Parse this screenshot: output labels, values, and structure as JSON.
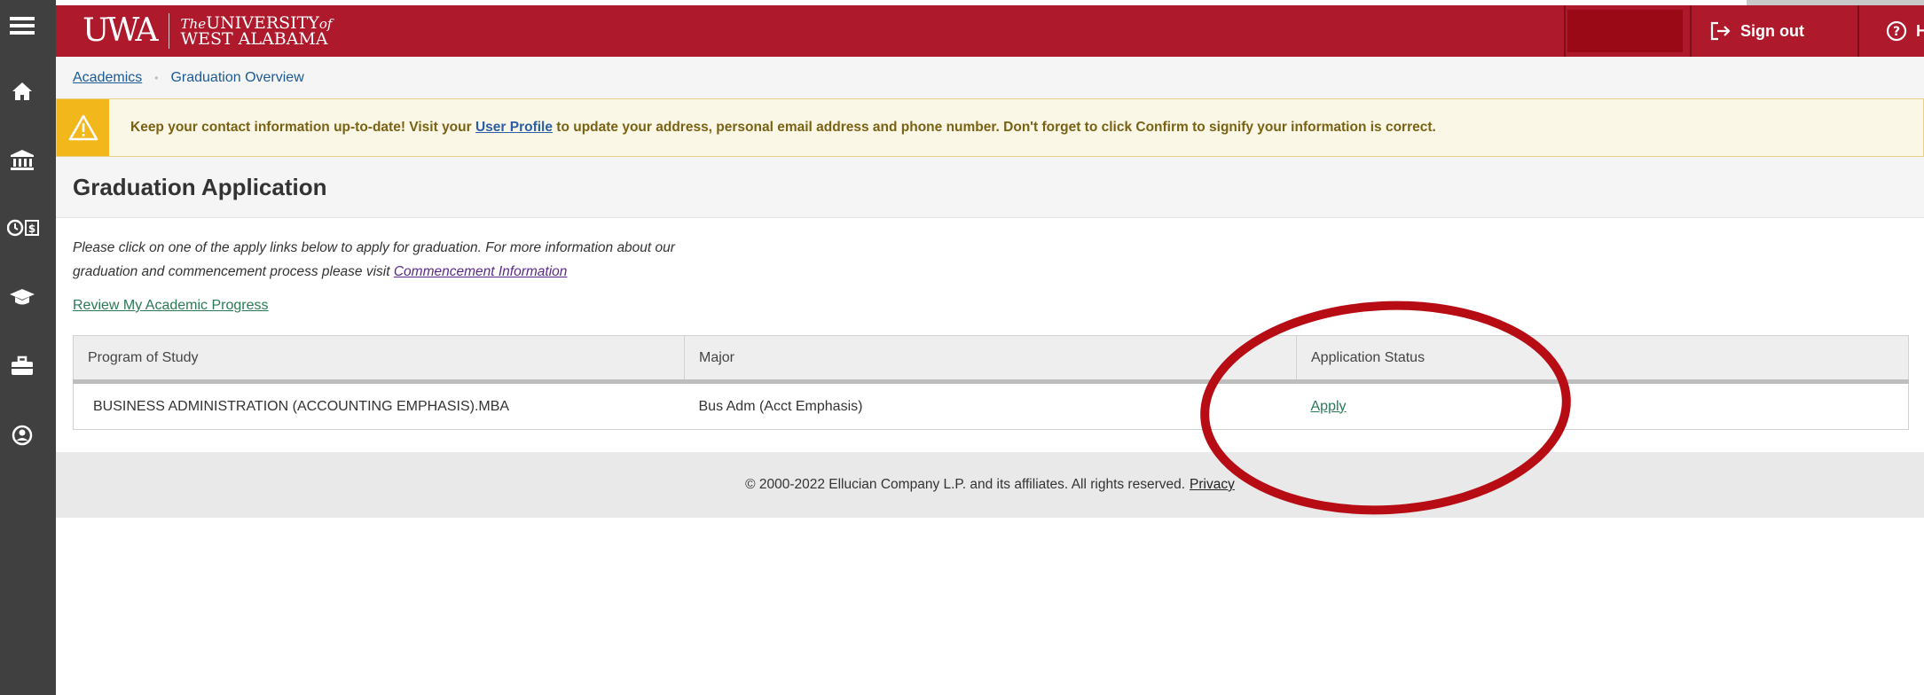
{
  "header": {
    "logo_mark": "UWA",
    "logo_line1_prefix": "The",
    "logo_line1_main": "UNIVERSITY",
    "logo_line1_suffix": "of",
    "logo_line2": "WEST ALABAMA",
    "sign_out": "Sign out",
    "help": "Help",
    "brand_color": "#ae1a2c"
  },
  "rail": {
    "icons": [
      "menu-icon",
      "home-icon",
      "bank-icon",
      "finance-icon",
      "graduation-cap-icon",
      "briefcase-icon",
      "user-circle-icon"
    ]
  },
  "breadcrumb": {
    "parent": "Academics",
    "separator": "•",
    "current": "Graduation Overview"
  },
  "notice": {
    "prefix": "Keep your contact information up-to-date! Visit your ",
    "link": "User Profile",
    "suffix": " to update your address, personal email address and phone number. Don't forget to click Confirm to signify your information is correct.",
    "icon": "warning-icon"
  },
  "page": {
    "title": "Graduation Application",
    "intro_line1": "Please click on one of the apply links below to apply for graduation. For more information about our",
    "intro_line2_prefix": "graduation and commencement process please visit ",
    "intro_link": "Commencement Information",
    "review_link": "Review My Academic Progress"
  },
  "table": {
    "headers": [
      "Program of Study",
      "Major",
      "Application Status"
    ],
    "rows": [
      {
        "program": "BUSINESS ADMINISTRATION (ACCOUNTING EMPHASIS).MBA",
        "major": "Bus Adm (Acct Emphasis)",
        "status": "Apply"
      }
    ]
  },
  "footer": {
    "copyright": "© 2000-2022 Ellucian Company L.P. and its affiliates. All rights reserved.",
    "privacy": "Privacy"
  },
  "annotation_color": "#b80c14"
}
